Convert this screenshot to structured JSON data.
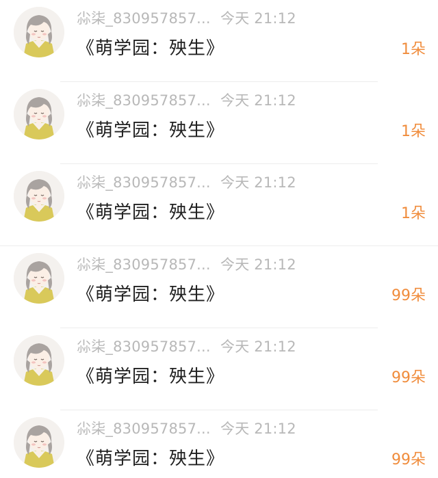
{
  "colors": {
    "meta_text": "#b8b8b8",
    "title_text": "#1f1f1f",
    "count_text": "#f08c3c",
    "divider": "#ececec"
  },
  "gifts": [
    {
      "user": "尛柒_830957857...",
      "time": "今天 21:12",
      "title": "《萌学园：殃生》",
      "count": "1朵",
      "avatar_icon": "anime-girl-avatar-icon"
    },
    {
      "user": "尛柒_830957857...",
      "time": "今天 21:12",
      "title": "《萌学园：殃生》",
      "count": "1朵",
      "avatar_icon": "anime-girl-avatar-icon"
    },
    {
      "user": "尛柒_830957857...",
      "time": "今天 21:12",
      "title": "《萌学园：殃生》",
      "count": "1朵",
      "avatar_icon": "anime-girl-avatar-icon"
    },
    {
      "user": "尛柒_830957857...",
      "time": "今天 21:12",
      "title": "《萌学园：殃生》",
      "count": "99朵",
      "avatar_icon": "anime-girl-avatar-icon"
    },
    {
      "user": "尛柒_830957857...",
      "time": "今天 21:12",
      "title": "《萌学园：殃生》",
      "count": "99朵",
      "avatar_icon": "anime-girl-avatar-icon"
    },
    {
      "user": "尛柒_830957857...",
      "time": "今天 21:12",
      "title": "《萌学园：殃生》",
      "count": "99朵",
      "avatar_icon": "anime-girl-avatar-icon"
    }
  ]
}
